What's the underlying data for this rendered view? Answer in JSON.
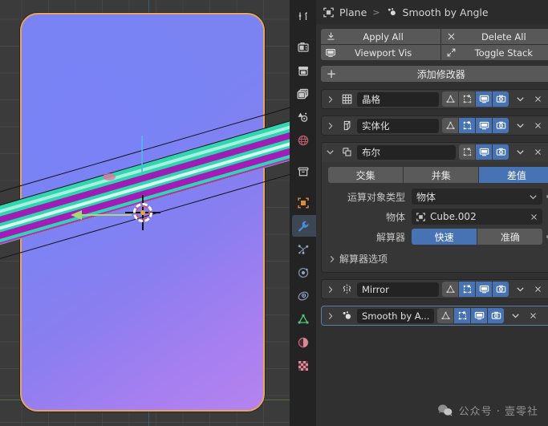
{
  "viewport": {
    "name": "3d-viewport",
    "object_outline_color": "#e8a35c",
    "surface_color": "#7b83f2",
    "band_colors": [
      "#2fd6b0",
      "#9c1fb5"
    ],
    "cursor_label": "3d-cursor",
    "gizmo_label": "move-gizmo-x"
  },
  "tabs": [
    {
      "id": "tool",
      "name": "tool-properties-tab",
      "active": false
    },
    {
      "id": "render",
      "name": "render-properties-tab",
      "active": false
    },
    {
      "id": "output",
      "name": "output-properties-tab",
      "active": false
    },
    {
      "id": "view-layer",
      "name": "view-layer-properties-tab",
      "active": false
    },
    {
      "id": "scene",
      "name": "scene-properties-tab",
      "active": false
    },
    {
      "id": "world",
      "name": "world-properties-tab",
      "active": false
    },
    {
      "id": "collection",
      "name": "collection-properties-tab",
      "active": false
    },
    {
      "id": "object",
      "name": "object-properties-tab",
      "active": false
    },
    {
      "id": "modifier",
      "name": "modifier-properties-tab",
      "active": true
    },
    {
      "id": "particles",
      "name": "particle-properties-tab",
      "active": false
    },
    {
      "id": "physics",
      "name": "physics-properties-tab",
      "active": false
    },
    {
      "id": "constraints",
      "name": "object-constraint-properties-tab",
      "active": false
    },
    {
      "id": "data",
      "name": "object-data-properties-tab",
      "active": false
    },
    {
      "id": "material",
      "name": "material-properties-tab",
      "active": false
    },
    {
      "id": "texture",
      "name": "texture-properties-tab",
      "active": false
    }
  ],
  "breadcrumb": {
    "object": "Plane",
    "separator": ">",
    "modifier": "Smooth by Angle",
    "pin_icon": "pin-icon"
  },
  "toolbar": {
    "apply_all": "Apply All",
    "delete_all": "Delete All",
    "viewport_vis": "Viewport Vis",
    "toggle_stack": "Toggle Stack",
    "add_modifier": "添加修改器",
    "add_icon": "+"
  },
  "modifiers": [
    {
      "name": "晶格",
      "icon": "lattice-icon",
      "expanded": false,
      "selected": false,
      "pinned": false,
      "toggles": [
        {
          "name": "edit-mode-toggle",
          "on": false
        },
        {
          "name": "on-cage-toggle",
          "on": false
        },
        {
          "name": "realtime-toggle",
          "on": true
        },
        {
          "name": "render-toggle",
          "on": true
        }
      ]
    },
    {
      "name": "实体化",
      "icon": "solidify-icon",
      "expanded": false,
      "selected": false,
      "pinned": false,
      "toggles": [
        {
          "name": "edit-mode-toggle",
          "on": false
        },
        {
          "name": "on-cage-toggle",
          "on": true
        },
        {
          "name": "realtime-toggle",
          "on": true
        },
        {
          "name": "render-toggle",
          "on": true
        }
      ]
    },
    {
      "name": "布尔",
      "icon": "boolean-icon",
      "expanded": true,
      "selected": false,
      "pinned": false,
      "toggles": [
        {
          "name": "on-cage-toggle",
          "on": false
        },
        {
          "name": "realtime-toggle",
          "on": true
        },
        {
          "name": "render-toggle",
          "on": true
        }
      ]
    },
    {
      "name": "Mirror",
      "icon": "mirror-icon",
      "expanded": false,
      "selected": false,
      "pinned": false,
      "toggles": [
        {
          "name": "edit-mode-toggle",
          "on": false
        },
        {
          "name": "on-cage-toggle",
          "on": true
        },
        {
          "name": "realtime-toggle",
          "on": true
        },
        {
          "name": "render-toggle",
          "on": true
        }
      ]
    },
    {
      "name": "Smooth by A...",
      "icon": "smooth-by-angle-icon",
      "expanded": false,
      "selected": true,
      "pinned": true,
      "toggles": [
        {
          "name": "edit-mode-toggle",
          "on": false
        },
        {
          "name": "on-cage-toggle",
          "on": true
        },
        {
          "name": "realtime-toggle",
          "on": true
        },
        {
          "name": "render-toggle",
          "on": true
        }
      ]
    }
  ],
  "boolean_panel": {
    "operations": [
      {
        "label": "交集",
        "active": false
      },
      {
        "label": "并集",
        "active": false
      },
      {
        "label": "差值",
        "active": true
      }
    ],
    "operand_type": {
      "label": "运算对象类型",
      "value": "物体"
    },
    "object": {
      "label": "物体",
      "value": "Cube.002",
      "icon": "object-icon",
      "clear_icon": "x-icon"
    },
    "solver": {
      "label": "解算器",
      "options": [
        {
          "label": "快速",
          "active": true
        },
        {
          "label": "准确",
          "active": false
        }
      ]
    },
    "solver_options": "解算器选项"
  },
  "watermark": {
    "icon": "wechat-icon",
    "text": "公众号 · 壹零社"
  },
  "colors": {
    "accent_blue": "#4772b3",
    "panel_bg": "#303030",
    "row_bg": "#3a3a3a",
    "field_bg": "#232323"
  }
}
